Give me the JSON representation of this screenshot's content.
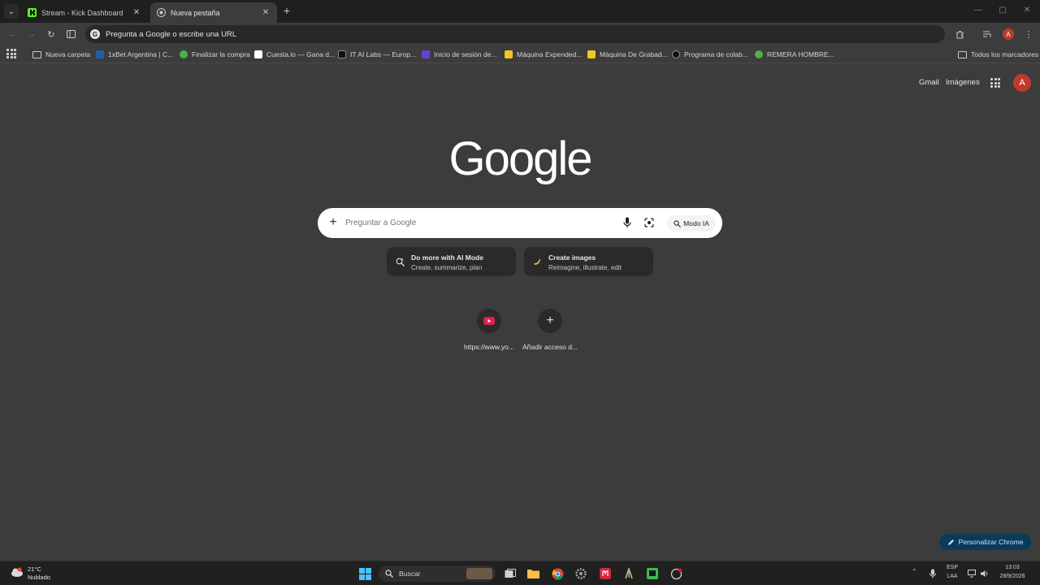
{
  "tabs": [
    {
      "title": "Stream - Kick Dashboard",
      "active": false
    },
    {
      "title": "Nueva pestaña",
      "active": true
    }
  ],
  "omnibox": {
    "text": "Pregunta a Google o escribe una URL"
  },
  "bookmarks": {
    "items": [
      "Nueva carpeta",
      "1xBet Argentina | C...",
      "Finalizar la compra",
      "Cuesta.io — Gana d...",
      "IT AI Labs — Europ...",
      "Inicio de sesión de...",
      "Máquina Expended...",
      "Máquina De Grabad...",
      "Programa de colab...",
      "REMERA HOMBRE..."
    ],
    "all": "Todos los marcadores"
  },
  "header": {
    "gmail": "Gmail",
    "images": "Imágenes",
    "avatar_letter": "A"
  },
  "logo": "Google",
  "search": {
    "placeholder": "Preguntar a Google",
    "ai_mode": "Modo IA"
  },
  "cards": [
    {
      "title": "Do more with AI Mode",
      "subtitle": "Create, summarize, plan"
    },
    {
      "title": "Create images",
      "subtitle": "Reimagine, illustrate, edit"
    }
  ],
  "shortcuts": [
    {
      "label": "https://www.yo..."
    },
    {
      "label": "Añadir acceso d..."
    }
  ],
  "customize": "Personalizar Chrome",
  "taskbar": {
    "weather_temp": "21°C",
    "weather_desc": "Nublado",
    "search": "Buscar",
    "lang1": "ESP",
    "lang2": "LAA",
    "time": "13:03",
    "date": "28/9/2026"
  },
  "colors": {
    "accent": "#c0392b",
    "customize_bg": "#0a3a5c",
    "customize_fg": "#c2e7ff"
  }
}
